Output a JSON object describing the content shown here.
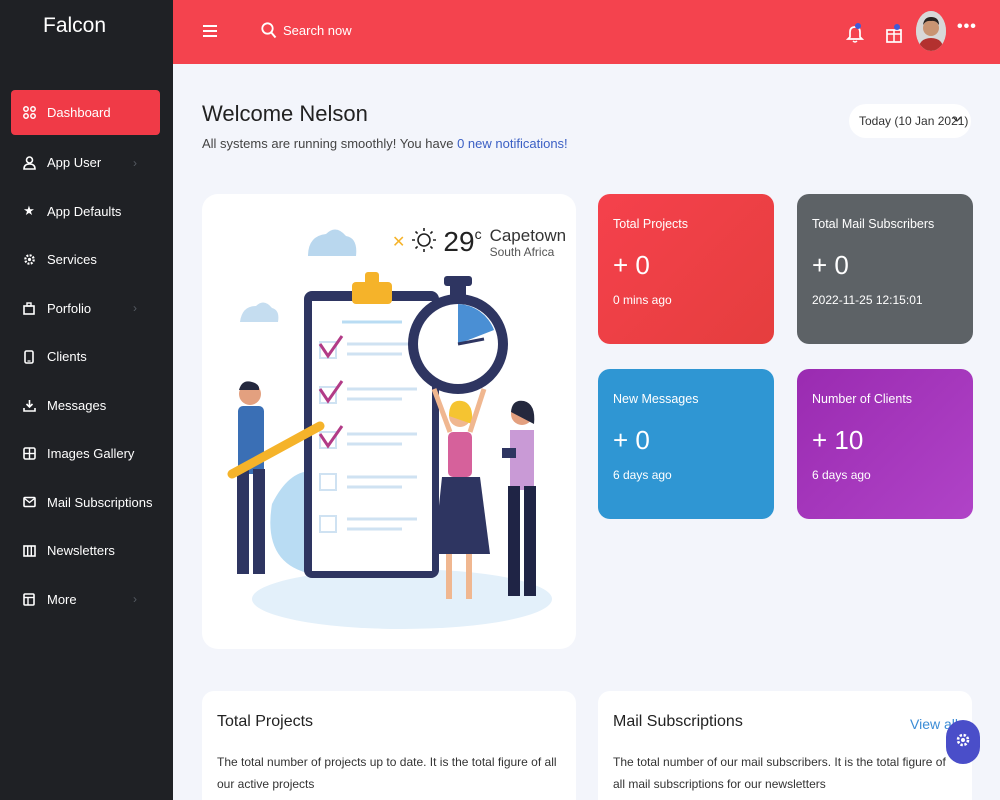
{
  "app": {
    "brand": "Falcon"
  },
  "sidebar": {
    "items": [
      {
        "label": "Dashboard",
        "icon": "grid-icon",
        "active": true,
        "chevron": false
      },
      {
        "label": "App User",
        "icon": "user-icon",
        "active": false,
        "chevron": true
      },
      {
        "label": "App Defaults",
        "icon": "star-icon",
        "active": false,
        "chevron": false
      },
      {
        "label": "Services",
        "icon": "gear-icon",
        "active": false,
        "chevron": false
      },
      {
        "label": "Porfolio",
        "icon": "briefcase-icon",
        "active": false,
        "chevron": true
      },
      {
        "label": "Clients",
        "icon": "phone-icon",
        "active": false,
        "chevron": false
      },
      {
        "label": "Messages",
        "icon": "download-icon",
        "active": false,
        "chevron": false
      },
      {
        "label": "Images Gallery",
        "icon": "gallery-icon",
        "active": false,
        "chevron": false
      },
      {
        "label": "Mail Subscriptions",
        "icon": "mail-icon",
        "active": false,
        "chevron": false
      },
      {
        "label": "Newsletters",
        "icon": "columns-icon",
        "active": false,
        "chevron": false
      },
      {
        "label": "More",
        "icon": "window-icon",
        "active": false,
        "chevron": true
      }
    ]
  },
  "header": {
    "search_placeholder": "Search now",
    "icons": [
      "menu-icon",
      "search-icon",
      "bell-icon",
      "gift-icon",
      "avatar",
      "more-icon"
    ],
    "more": "•••"
  },
  "welcome": {
    "title": "Welcome Nelson",
    "sub_prefix": "All systems are running smoothly! You have ",
    "sub_link": "0 new notifications!",
    "date": "Today (10 Jan 2021)"
  },
  "weather": {
    "temp": "29",
    "unit": "c",
    "city": "Capetown",
    "country": "South Africa",
    "icon": "sun-icon"
  },
  "stats": [
    {
      "label": "Total Projects",
      "value": "+ 0",
      "time": "0 mins ago",
      "color": "#f5414c"
    },
    {
      "label": "Total Mail Subscribers",
      "value": "+ 0",
      "time": "2022-11-25 12:15:01",
      "color": "#5d6266"
    },
    {
      "label": "New Messages",
      "value": "+ 0",
      "time": "6 days ago",
      "color": "#2f96d3"
    },
    {
      "label": "Number of Clients",
      "value": "+ 10",
      "time": "6 days ago",
      "color": "#a33abb"
    }
  ],
  "bottom_cards": [
    {
      "title": "Total Projects",
      "desc": "The total number of projects up to date. It is the total figure of all our active projects"
    },
    {
      "title": "Mail Subscriptions",
      "desc": "The total number of our mail subscribers. It is the total figure of all mail subscriptions for our newsletters",
      "link": "View all"
    }
  ],
  "colors": {
    "accent": "#f4434e",
    "sidebar": "#1f2125",
    "link": "#3b5fc4"
  }
}
